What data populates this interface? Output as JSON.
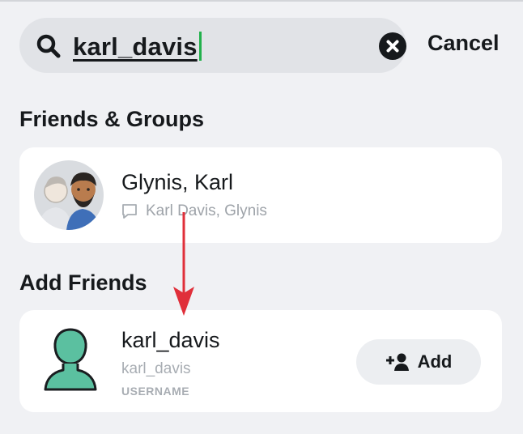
{
  "search": {
    "query": "karl_davis",
    "cancel_label": "Cancel"
  },
  "sections": {
    "friends_groups": "Friends & Groups",
    "add_friends": "Add Friends"
  },
  "group_result": {
    "name": "Glynis, Karl",
    "members": "Karl Davis, Glynis",
    "icon": "chat-bubble-icon"
  },
  "user_result": {
    "display_name": "karl_davis",
    "username": "karl_davis",
    "tag": "USERNAME",
    "add_label": "Add",
    "icon": "add-friend-icon"
  },
  "colors": {
    "background": "#f0f1f4",
    "card": "#ffffff",
    "search_bg": "#e1e3e7",
    "accent_caret": "#22b14c",
    "arrow": "#e02f3a",
    "avatar_silhouette": "#5bc0a0"
  }
}
